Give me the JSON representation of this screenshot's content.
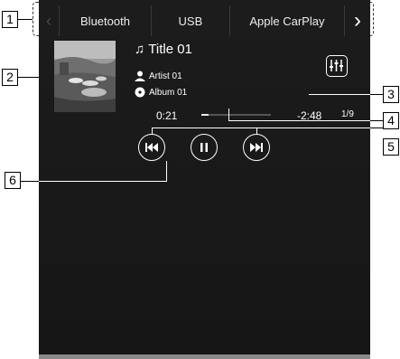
{
  "tabs": [
    {
      "label": "Bluetooth"
    },
    {
      "label": "USB"
    },
    {
      "label": "Apple CarPlay"
    }
  ],
  "arrows": {
    "left_icon": "chevron-left-icon",
    "right_icon": "chevron-right-icon"
  },
  "now_playing": {
    "title": "Title 01",
    "artist": "Artist 01",
    "album": "Album 01",
    "track_count": "1/9",
    "elapsed": "0:21",
    "remaining": "-2:48",
    "progress_fraction": 0.11
  },
  "controls": {
    "prev_icon": "skip-previous-icon",
    "pause_icon": "pause-icon",
    "next_icon": "skip-next-icon",
    "equalizer_icon": "equalizer-icon"
  },
  "callouts": [
    "1",
    "2",
    "3",
    "4",
    "5",
    "6"
  ],
  "colors": {
    "screen_bg": "#1a1a1a",
    "text": "#ffffff",
    "callout_border": "#000000"
  }
}
